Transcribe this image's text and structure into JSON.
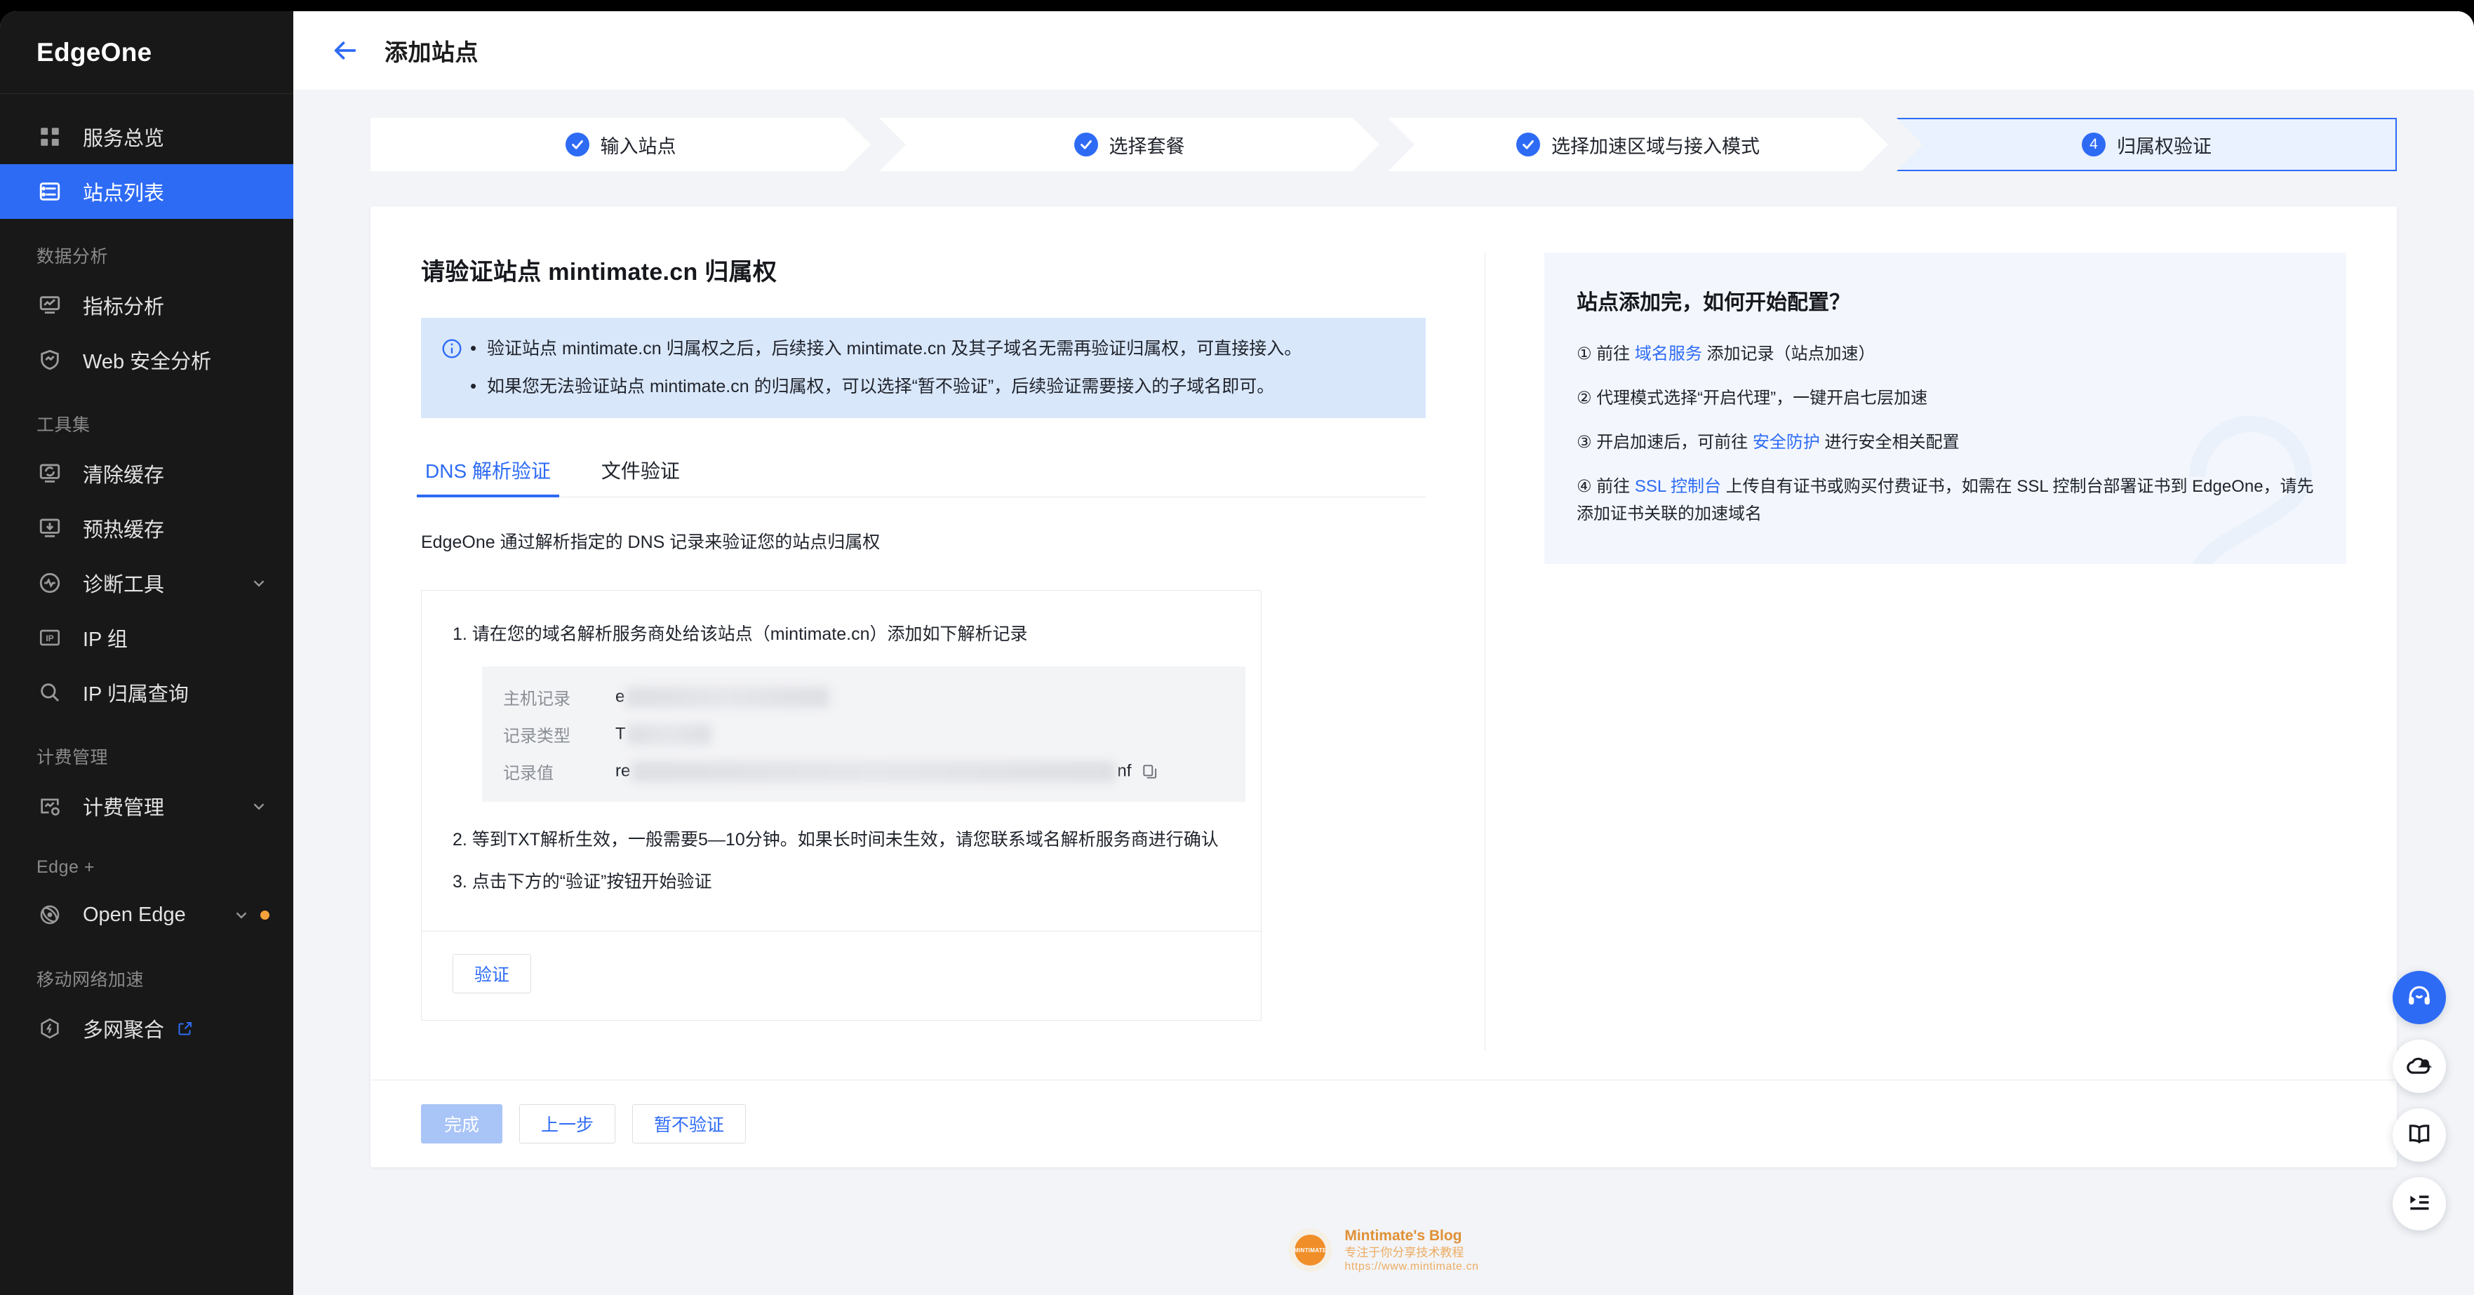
{
  "brand": {
    "name": "EdgeOne"
  },
  "sidebar": {
    "items": [
      {
        "label": "服务总览",
        "icon": "grid-icon",
        "type": "item",
        "active": false
      },
      {
        "label": "站点列表",
        "icon": "list-rows-icon",
        "type": "item",
        "active": true
      },
      {
        "label": "数据分析",
        "type": "group"
      },
      {
        "label": "指标分析",
        "icon": "chart-monitor-icon",
        "type": "item",
        "active": false
      },
      {
        "label": "Web 安全分析",
        "icon": "shield-chart-icon",
        "type": "item",
        "active": false
      },
      {
        "label": "工具集",
        "type": "group"
      },
      {
        "label": "清除缓存",
        "icon": "cache-purge-icon",
        "type": "item",
        "active": false
      },
      {
        "label": "预热缓存",
        "icon": "cache-prefetch-icon",
        "type": "item",
        "active": false
      },
      {
        "label": "诊断工具",
        "icon": "pulse-circle-icon",
        "type": "item",
        "active": false,
        "expandable": true
      },
      {
        "label": "IP 组",
        "icon": "ip-box-icon",
        "type": "item",
        "active": false
      },
      {
        "label": "IP 归属查询",
        "icon": "search-icon",
        "type": "item",
        "active": false
      },
      {
        "label": "计费管理",
        "type": "group"
      },
      {
        "label": "计费管理",
        "icon": "billing-icon",
        "type": "item",
        "active": false,
        "expandable": true
      },
      {
        "label": "Edge +",
        "type": "group"
      },
      {
        "label": "Open Edge",
        "icon": "open-edge-icon",
        "type": "item",
        "active": false,
        "expandable": true,
        "badge_dot": true
      },
      {
        "label": "移动网络加速",
        "type": "group"
      },
      {
        "label": "多网聚合",
        "icon": "hex-bolt-icon",
        "type": "item",
        "active": false,
        "external": true
      }
    ]
  },
  "topbar": {
    "back_icon": "arrow-left-icon",
    "title": "添加站点"
  },
  "stepper": {
    "steps": [
      {
        "num": "1",
        "label": "输入站点",
        "state": "done"
      },
      {
        "num": "2",
        "label": "选择套餐",
        "state": "done"
      },
      {
        "num": "3",
        "label": "选择加速区域与接入模式",
        "state": "done"
      },
      {
        "num": "4",
        "label": "归属权验证",
        "state": "current"
      }
    ]
  },
  "main": {
    "heading": "请验证站点 mintimate.cn 归属权",
    "info_icon": "info-circle-icon",
    "info_items": [
      "验证站点 mintimate.cn 归属权之后，后续接入 mintimate.cn 及其子域名无需再验证归属权，可直接接入。",
      "如果您无法验证站点 mintimate.cn 的归属权，可以选择“暂不验证”，后续验证需要接入的子域名即可。"
    ],
    "tabs": [
      {
        "label": "DNS 解析验证",
        "active": true
      },
      {
        "label": "文件验证",
        "active": false
      }
    ],
    "lead": "EdgeOne 通过解析指定的 DNS 记录来验证您的站点归属权",
    "steps": {
      "step1": "1. 请在您的域名解析服务商处给该站点（mintimate.cn）添加如下解析记录",
      "step2": "2. 等到TXT解析生效，一般需要5—10分钟。如果长时间未生效，请您联系域名解析服务商进行确认",
      "step3": "3. 点击下方的“验证”按钮开始验证"
    },
    "record": {
      "rows": [
        {
          "key": "主机记录",
          "value_prefix": "e",
          "value_suffix": "",
          "redacted": true
        },
        {
          "key": "记录类型",
          "value_prefix": "T",
          "value_suffix": "",
          "redacted": true
        },
        {
          "key": "记录值",
          "value_prefix": "re",
          "value_suffix": "nf",
          "redacted": true,
          "copy_icon": "copy-icon"
        }
      ]
    },
    "verify_button": "验证"
  },
  "help": {
    "title": "站点添加完，如何开始配置？",
    "items": [
      {
        "num": "①",
        "pre": "前往 ",
        "link": "域名服务",
        "post": " 添加记录（站点加速）"
      },
      {
        "num": "②",
        "pre": "代理模式选择“开启代理”，一键开启七层加速",
        "link": "",
        "post": ""
      },
      {
        "num": "③",
        "pre": "开启加速后，可前往 ",
        "link": "安全防护",
        "post": " 进行安全相关配置"
      },
      {
        "num": "④",
        "pre": "前往 ",
        "link": "SSL 控制台",
        "post": " 上传自有证书或购买付费证书，如需在 SSL 控制台部署证书到 EdgeOne，请先添加证书关联的加速域名"
      }
    ]
  },
  "footer": {
    "buttons": [
      {
        "label": "完成",
        "kind": "primary-disabled"
      },
      {
        "label": "上一步",
        "kind": "default"
      },
      {
        "label": "暂不验证",
        "kind": "default"
      }
    ]
  },
  "watermark": {
    "logo_text": "MINTIMATE",
    "title": "Mintimate's Blog",
    "subtitle": "专注于你分享技术教程",
    "url": "https://www.mintimate.cn"
  },
  "fabs": [
    {
      "icon": "headset-icon",
      "primary": true
    },
    {
      "icon": "cloud-bell-icon",
      "primary": false
    },
    {
      "icon": "book-icon",
      "primary": false
    },
    {
      "icon": "list-play-icon",
      "primary": false
    }
  ],
  "colors": {
    "accent": "#2e6bf5",
    "sidebar_bg": "#181818",
    "page_bg": "#f2f4f7",
    "info_bg": "#d9e7fb",
    "help_bg": "#f3f7fd",
    "brand_orange": "#f08a1e"
  }
}
